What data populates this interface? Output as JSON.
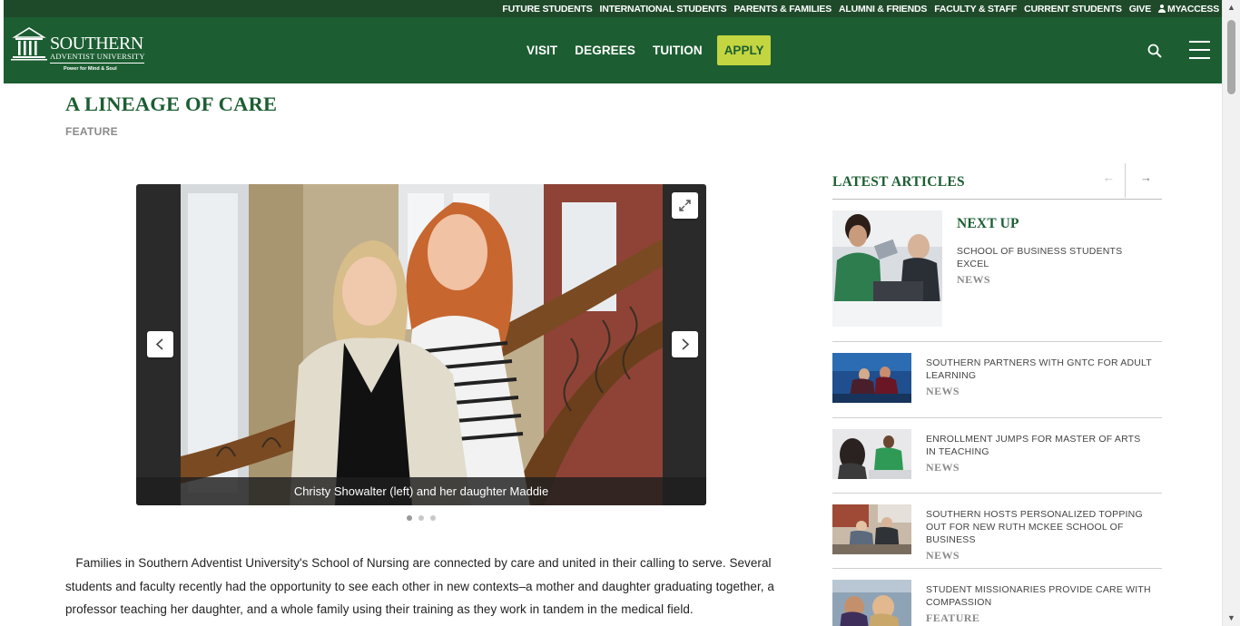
{
  "utility_nav": {
    "links": [
      "FUTURE STUDENTS",
      "INTERNATIONAL STUDENTS",
      "PARENTS & FAMILIES",
      "ALUMNI & FRIENDS",
      "FACULTY & STAFF",
      "CURRENT STUDENTS",
      "GIVE"
    ],
    "myaccess": "MYACCESS"
  },
  "header": {
    "logo": {
      "name": "SOUTHERN",
      "subtitle": "ADVENTIST UNIVERSITY",
      "tagline": "Power for Mind & Soul"
    },
    "nav": [
      "VISIT",
      "DEGREES",
      "TUITION"
    ],
    "apply": "APPLY"
  },
  "article": {
    "title": "A LINEAGE OF CARE",
    "category": "FEATURE",
    "gallery": {
      "caption": "Christy Showalter (left) and her daughter Maddie",
      "slide_count": 3,
      "active_slide": 1
    },
    "body": "Families in Southern Adventist University's School of Nursing are connected by care and united in their calling to serve. Several students and faculty recently had the opportunity to see each other in new contexts–a mother and daughter graduating together, a professor teaching her daughter, and a whole family using their training as they work in tandem in the medical field."
  },
  "sidebar": {
    "heading": "LATEST ARTICLES",
    "next_up": {
      "label": "NEXT UP",
      "title": "SCHOOL OF BUSINESS STUDENTS EXCEL",
      "category": "NEWS"
    },
    "articles": [
      {
        "title": "SOUTHERN PARTNERS WITH GNTC FOR ADULT LEARNING",
        "category": "NEWS"
      },
      {
        "title": "ENROLLMENT JUMPS FOR MASTER OF ARTS IN TEACHING",
        "category": "NEWS"
      },
      {
        "title": "SOUTHERN HOSTS PERSONALIZED TOPPING OUT FOR NEW RUTH MCKEE SCHOOL OF BUSINESS",
        "category": "NEWS"
      },
      {
        "title": "STUDENT MISSIONARIES PROVIDE CARE WITH COMPASSION",
        "category": "FEATURE"
      }
    ]
  },
  "colors": {
    "brand_green": "#1c5e32",
    "utility_green": "#1f4a2a",
    "apply_yellow": "#c3d540"
  }
}
